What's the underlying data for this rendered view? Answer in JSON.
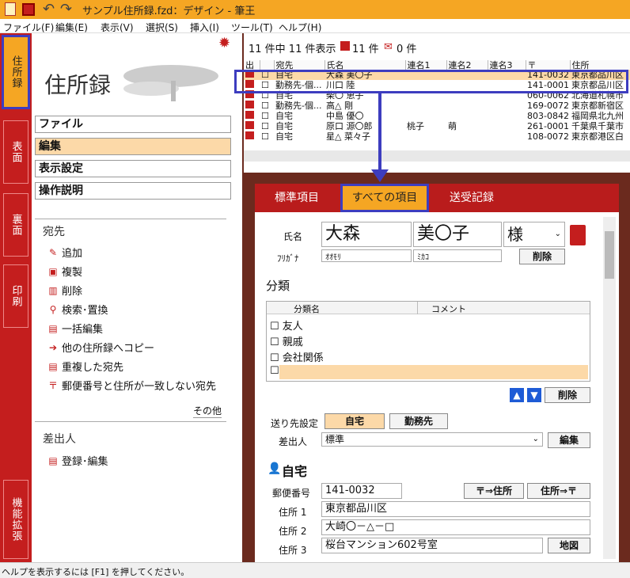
{
  "window": {
    "title": "サンプル住所録.fzd：デザイン - 筆王"
  },
  "menu": [
    "ファイル(F)",
    "編集(E)",
    "表示(V)",
    "選択(S)",
    "挿入(I)",
    "ツール(T)",
    "ヘルプ(H)"
  ],
  "vtabs": {
    "t1": "住所録",
    "t2": "表面",
    "t3": "裏面",
    "t4": "印刷",
    "t5": "機能拡張"
  },
  "left": {
    "title": "住所録",
    "nav": {
      "n1": "ファイル",
      "n2": "編集",
      "n3": "表示設定",
      "n4": "操作説明"
    },
    "section1": "宛先",
    "actions": {
      "a1": "追加",
      "a2": "複製",
      "a3": "削除",
      "a4": "検索･置換",
      "a5": "一括編集",
      "a6": "他の住所録へコピー",
      "a7": "重複した宛先",
      "a8": "郵便番号と住所が一致しない宛先"
    },
    "more": "その他",
    "section2": "差出人",
    "sender_action": "登録･編集"
  },
  "list": {
    "summary": "11 件中 11 件表示",
    "print_count": "11 件",
    "mail_count": "0 件",
    "headers": {
      "h1": "出",
      "h2": "宛先",
      "h3": "氏名",
      "h4": "連名1",
      "h5": "連名2",
      "h6": "連名3",
      "h7": "〒",
      "h8": "住所"
    },
    "rows": [
      {
        "dest": "自宅",
        "name": "大森 美〇子",
        "ren1": "",
        "ren2": "",
        "zip": "141-0032",
        "addr": "東京都品川区"
      },
      {
        "dest": "勤務先-個...",
        "name": "川口 陸",
        "ren1": "",
        "ren2": "",
        "zip": "141-0001",
        "addr": "東京都品川区"
      },
      {
        "dest": "自宅",
        "name": "柴〇 恵子",
        "ren1": "",
        "ren2": "",
        "zip": "060-0062",
        "addr": "北海道札幌市"
      },
      {
        "dest": "勤務先-個...",
        "name": "高△ 剛",
        "ren1": "",
        "ren2": "",
        "zip": "169-0072",
        "addr": "東京都新宿区"
      },
      {
        "dest": "自宅",
        "name": "中島 優〇",
        "ren1": "",
        "ren2": "",
        "zip": "803-0842",
        "addr": "福岡県北九州"
      },
      {
        "dest": "自宅",
        "name": "原口 源〇郎",
        "ren1": "桃子",
        "ren2": "萌",
        "zip": "261-0001",
        "addr": "千葉県千葉市"
      },
      {
        "dest": "自宅",
        "name": "星△ 菜々子",
        "ren1": "",
        "ren2": "",
        "zip": "108-0072",
        "addr": "東京都港区白"
      }
    ]
  },
  "form": {
    "tabs": {
      "t1": "標準項目",
      "t2": "すべての項目",
      "t3": "送受記録"
    },
    "name_label": "氏名",
    "last": "大森",
    "first": "美〇子",
    "honorific": "様",
    "furigana_label": "ﾌﾘｶﾞﾅ",
    "kana_last": "ｵｵﾓﾘ",
    "kana_first": "ﾐｶｺ",
    "delete": "削除",
    "category_title": "分類",
    "cat_col1": "分類名",
    "cat_col2": "コメント",
    "categories": {
      "c1": "友人",
      "c2": "親戚",
      "c3": "会社関係"
    },
    "send_label": "送り先設定",
    "send_home": "自宅",
    "send_work": "勤務先",
    "sender_label": "差出人",
    "sender_value": "標準",
    "edit": "編集",
    "home_title": "自宅",
    "zip_label": "郵便番号",
    "zip": "141-0032",
    "zip_to_addr": "〒⇒住所",
    "addr_to_zip": "住所⇒〒",
    "addr1_label": "住所 1",
    "addr1": "東京都品川区",
    "addr2_label": "住所 2",
    "addr2": "大崎〇－△－□",
    "addr3_label": "住所 3",
    "addr3": "桜台マンション602号室",
    "map": "地図"
  },
  "status": "ヘルプを表示するには [F1] を押してください。"
}
